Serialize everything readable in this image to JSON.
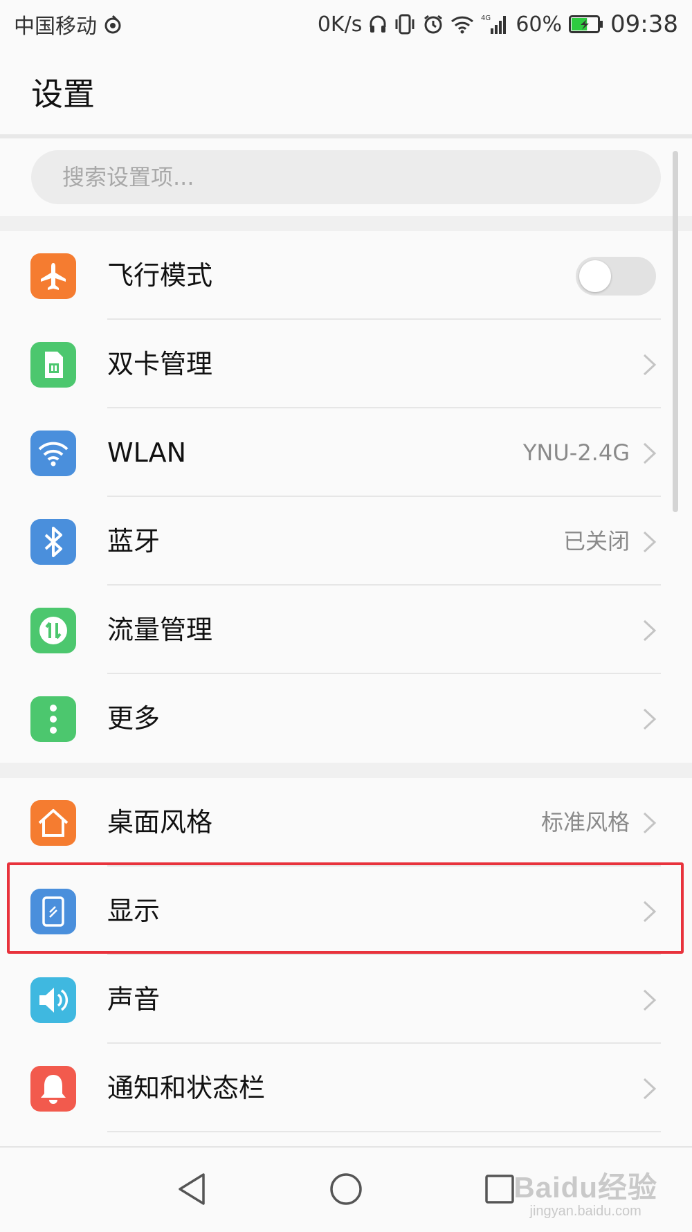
{
  "status_bar": {
    "carrier": "中国移动",
    "network_speed": "0K/s",
    "network_type": "4G",
    "battery_percent": "60%",
    "battery_level": 0.6,
    "time": "09:38"
  },
  "header": {
    "title": "设置"
  },
  "search": {
    "placeholder": "搜索设置项..."
  },
  "groups": [
    {
      "items": [
        {
          "label": "飞行模式",
          "icon": "airplane-icon",
          "color": "#f57c30",
          "toggle": false
        },
        {
          "label": "双卡管理",
          "icon": "sim-card-icon",
          "color": "#4cc76e"
        },
        {
          "label": "WLAN",
          "icon": "wifi-icon",
          "color": "#4a8fdc",
          "value": "YNU-2.4G"
        },
        {
          "label": "蓝牙",
          "icon": "bluetooth-icon",
          "color": "#4a8fdc",
          "value": "已关闭"
        },
        {
          "label": "流量管理",
          "icon": "data-usage-icon",
          "color": "#4cc76e"
        },
        {
          "label": "更多",
          "icon": "more-dots-icon",
          "color": "#4cc76e"
        }
      ]
    },
    {
      "items": [
        {
          "label": "桌面风格",
          "icon": "home-icon",
          "color": "#f57c30",
          "value": "标准风格"
        },
        {
          "label": "显示",
          "icon": "display-icon",
          "color": "#4a8fdc",
          "highlighted": true
        },
        {
          "label": "声音",
          "icon": "speaker-icon",
          "color": "#3fb8e0"
        },
        {
          "label": "通知和状态栏",
          "icon": "bell-icon",
          "color": "#f25a4d"
        }
      ]
    }
  ],
  "highlight_color": "#e8323c",
  "nav_bar": {
    "buttons": [
      "back-icon",
      "home-circle-icon",
      "recents-icon"
    ]
  },
  "watermark": {
    "logo": "Baidu经验",
    "url": "jingyan.baidu.com"
  }
}
